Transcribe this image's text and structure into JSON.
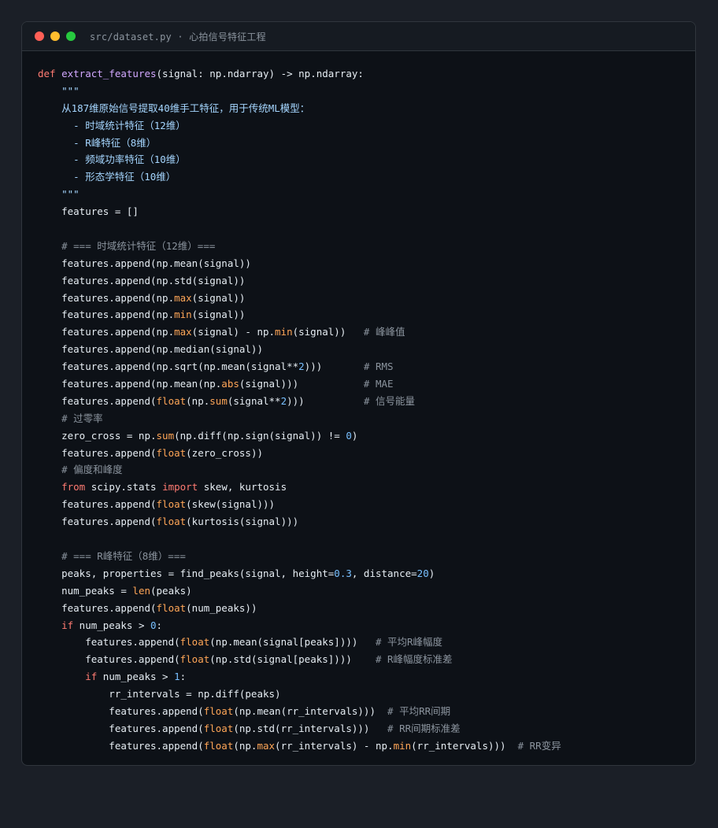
{
  "window": {
    "title": "src/dataset.py · 心拍信号特征工程",
    "buttons": [
      "close",
      "minimize",
      "zoom"
    ]
  },
  "colors": {
    "background": "#1b1f27",
    "editor": "#0d1117",
    "keyword": "#ff7b72",
    "function": "#d2a8ff",
    "builtin": "#ffa657",
    "number": "#79c0ff",
    "string": "#a5d6ff",
    "comment": "#8b949e",
    "text": "#e6edf3"
  },
  "code": [
    [
      [
        "kw",
        "def "
      ],
      [
        "fn",
        "extract_features"
      ],
      [
        "pl",
        "(signal: np.ndarray) -> np.ndarray:"
      ]
    ],
    [
      [
        "str",
        "    \"\"\""
      ]
    ],
    [
      [
        "str",
        "    从187维原始信号提取40维手工特征，用于传统ML模型："
      ]
    ],
    [
      [
        "str",
        "      - 时域统计特征（12维）"
      ]
    ],
    [
      [
        "str",
        "      - R峰特征（8维）"
      ]
    ],
    [
      [
        "str",
        "      - 频域功率特征（10维）"
      ]
    ],
    [
      [
        "str",
        "      - 形态学特征（10维）"
      ]
    ],
    [
      [
        "str",
        "    \"\"\""
      ]
    ],
    [
      [
        "pl",
        "    features = []"
      ]
    ],
    [],
    [
      [
        "cm",
        "    # === 时域统计特征（12维）==="
      ]
    ],
    [
      [
        "pl",
        "    features.append(np.mean(signal))"
      ]
    ],
    [
      [
        "pl",
        "    features.append(np.std(signal))"
      ]
    ],
    [
      [
        "pl",
        "    features.append(np."
      ],
      [
        "bi",
        "max"
      ],
      [
        "pl",
        "(signal))"
      ]
    ],
    [
      [
        "pl",
        "    features.append(np."
      ],
      [
        "bi",
        "min"
      ],
      [
        "pl",
        "(signal))"
      ]
    ],
    [
      [
        "pl",
        "    features.append(np."
      ],
      [
        "bi",
        "max"
      ],
      [
        "pl",
        "(signal) - np."
      ],
      [
        "bi",
        "min"
      ],
      [
        "pl",
        "(signal))   "
      ],
      [
        "cm",
        "# 峰峰值"
      ]
    ],
    [
      [
        "pl",
        "    features.append(np.median(signal))"
      ]
    ],
    [
      [
        "pl",
        "    features.append(np.sqrt(np.mean(signal**"
      ],
      [
        "num",
        "2"
      ],
      [
        "pl",
        ")))       "
      ],
      [
        "cm",
        "# RMS"
      ]
    ],
    [
      [
        "pl",
        "    features.append(np.mean(np."
      ],
      [
        "bi",
        "abs"
      ],
      [
        "pl",
        "(signal)))           "
      ],
      [
        "cm",
        "# MAE"
      ]
    ],
    [
      [
        "pl",
        "    features.append("
      ],
      [
        "bi",
        "float"
      ],
      [
        "pl",
        "(np."
      ],
      [
        "bi",
        "sum"
      ],
      [
        "pl",
        "(signal**"
      ],
      [
        "num",
        "2"
      ],
      [
        "pl",
        ")))          "
      ],
      [
        "cm",
        "# 信号能量"
      ]
    ],
    [
      [
        "cm",
        "    # 过零率"
      ]
    ],
    [
      [
        "pl",
        "    zero_cross = np."
      ],
      [
        "bi",
        "sum"
      ],
      [
        "pl",
        "(np.diff(np.sign(signal)) != "
      ],
      [
        "num",
        "0"
      ],
      [
        "pl",
        ")"
      ]
    ],
    [
      [
        "pl",
        "    features.append("
      ],
      [
        "bi",
        "float"
      ],
      [
        "pl",
        "(zero_cross))"
      ]
    ],
    [
      [
        "cm",
        "    # 偏度和峰度"
      ]
    ],
    [
      [
        "kw",
        "    from"
      ],
      [
        "pl",
        " scipy.stats "
      ],
      [
        "kw",
        "import"
      ],
      [
        "pl",
        " skew, kurtosis"
      ]
    ],
    [
      [
        "pl",
        "    features.append("
      ],
      [
        "bi",
        "float"
      ],
      [
        "pl",
        "(skew(signal)))"
      ]
    ],
    [
      [
        "pl",
        "    features.append("
      ],
      [
        "bi",
        "float"
      ],
      [
        "pl",
        "(kurtosis(signal)))"
      ]
    ],
    [],
    [
      [
        "cm",
        "    # === R峰特征（8维）==="
      ]
    ],
    [
      [
        "pl",
        "    peaks, properties = find_peaks(signal, height="
      ],
      [
        "num",
        "0.3"
      ],
      [
        "pl",
        ", distance="
      ],
      [
        "num",
        "20"
      ],
      [
        "pl",
        ")"
      ]
    ],
    [
      [
        "pl",
        "    num_peaks = "
      ],
      [
        "bi",
        "len"
      ],
      [
        "pl",
        "(peaks)"
      ]
    ],
    [
      [
        "pl",
        "    features.append("
      ],
      [
        "bi",
        "float"
      ],
      [
        "pl",
        "(num_peaks))"
      ]
    ],
    [
      [
        "kw",
        "    if"
      ],
      [
        "pl",
        " num_peaks > "
      ],
      [
        "num",
        "0"
      ],
      [
        "pl",
        ":"
      ]
    ],
    [
      [
        "pl",
        "        features.append("
      ],
      [
        "bi",
        "float"
      ],
      [
        "pl",
        "(np.mean(signal[peaks])))   "
      ],
      [
        "cm",
        "# 平均R峰幅度"
      ]
    ],
    [
      [
        "pl",
        "        features.append("
      ],
      [
        "bi",
        "float"
      ],
      [
        "pl",
        "(np.std(signal[peaks])))    "
      ],
      [
        "cm",
        "# R峰幅度标准差"
      ]
    ],
    [
      [
        "kw",
        "        if"
      ],
      [
        "pl",
        " num_peaks > "
      ],
      [
        "num",
        "1"
      ],
      [
        "pl",
        ":"
      ]
    ],
    [
      [
        "pl",
        "            rr_intervals = np.diff(peaks)"
      ]
    ],
    [
      [
        "pl",
        "            features.append("
      ],
      [
        "bi",
        "float"
      ],
      [
        "pl",
        "(np.mean(rr_intervals)))  "
      ],
      [
        "cm",
        "# 平均RR间期"
      ]
    ],
    [
      [
        "pl",
        "            features.append("
      ],
      [
        "bi",
        "float"
      ],
      [
        "pl",
        "(np.std(rr_intervals)))   "
      ],
      [
        "cm",
        "# RR间期标准差"
      ]
    ],
    [
      [
        "pl",
        "            features.append("
      ],
      [
        "bi",
        "float"
      ],
      [
        "pl",
        "(np."
      ],
      [
        "bi",
        "max"
      ],
      [
        "pl",
        "(rr_intervals) - np."
      ],
      [
        "bi",
        "min"
      ],
      [
        "pl",
        "(rr_intervals)))  "
      ],
      [
        "cm",
        "# RR变异"
      ]
    ]
  ]
}
